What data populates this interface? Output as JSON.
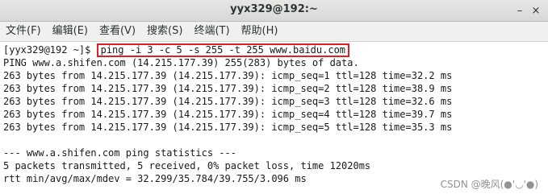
{
  "window": {
    "title": "yyx329@192:~",
    "minimize_glyph": "–",
    "close_glyph": "×"
  },
  "menubar": {
    "items": [
      "文件(F)",
      "编辑(E)",
      "查看(V)",
      "搜索(S)",
      "终端(T)",
      "帮助(H)"
    ]
  },
  "terminal": {
    "prompt": "[yyx329@192 ~]$ ",
    "command": "ping -i 3 -c 5 -s 255 -t 255 www.baidu.com",
    "lines": [
      "PING www.a.shifen.com (14.215.177.39) 255(283) bytes of data.",
      "263 bytes from 14.215.177.39 (14.215.177.39): icmp_seq=1 ttl=128 time=32.2 ms",
      "263 bytes from 14.215.177.39 (14.215.177.39): icmp_seq=2 ttl=128 time=38.9 ms",
      "263 bytes from 14.215.177.39 (14.215.177.39): icmp_seq=3 ttl=128 time=32.6 ms",
      "263 bytes from 14.215.177.39 (14.215.177.39): icmp_seq=4 ttl=128 time=39.7 ms",
      "263 bytes from 14.215.177.39 (14.215.177.39): icmp_seq=5 ttl=128 time=35.3 ms",
      "",
      "--- www.a.shifen.com ping statistics ---",
      "5 packets transmitted, 5 received, 0% packet loss, time 12020ms",
      "rtt min/avg/max/mdev = 32.299/35.784/39.755/3.096 ms"
    ]
  },
  "watermark": "CSDN @晚风(●'◡'●)"
}
